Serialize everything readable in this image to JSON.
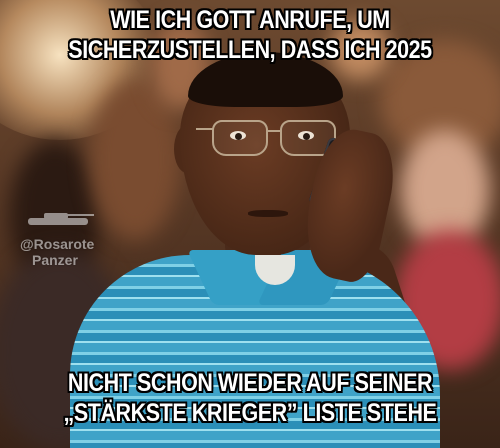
{
  "meme": {
    "top_text": [
      "WIE ICH GOTT ANRUFE, UM",
      "SICHERZUSTELLEN, DASS ICH 2025"
    ],
    "bottom_text": [
      "NICHT SCHON WIEDER AUF SEINER",
      "„STÄRKSTE KRIEGER” LISTE STEHE"
    ],
    "watermark": {
      "icon": "tank-icon",
      "handle": "@Rosarote",
      "handle_line2": "Panzer"
    }
  },
  "colors": {
    "caption_fill": "#ffffff",
    "caption_outline": "#000000",
    "shirt": "#3fa3c8"
  }
}
